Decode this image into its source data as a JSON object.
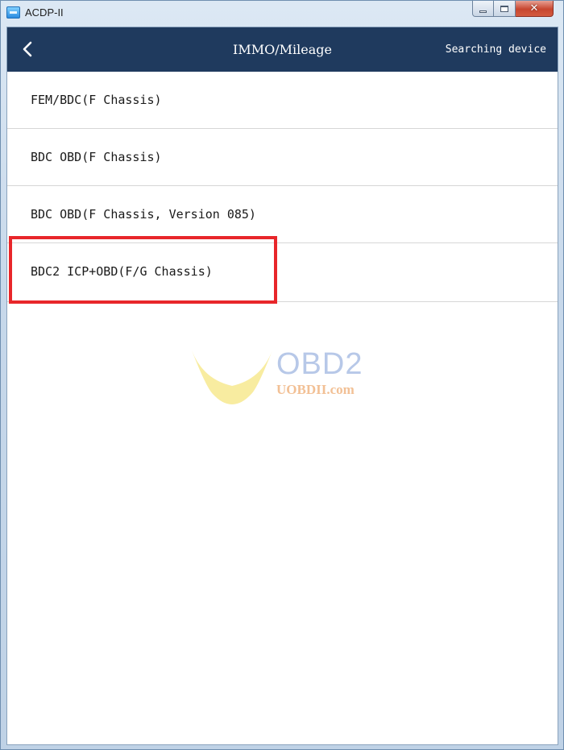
{
  "window": {
    "title": "ACDP-II",
    "close_symbol": "✕"
  },
  "header": {
    "back_icon": "chevron-left-icon",
    "title": "IMMO/Mileage",
    "status": "Searching device"
  },
  "menu": {
    "items": [
      {
        "label": "FEM/BDC(F Chassis)"
      },
      {
        "label": "BDC OBD(F Chassis)"
      },
      {
        "label": "BDC OBD(F Chassis, Version 085)"
      },
      {
        "label": "BDC2 ICP+OBD(F/G Chassis)",
        "highlighted": true
      }
    ]
  },
  "watermark": {
    "brand": "OBD2",
    "url": "UOBDII.com"
  },
  "colors": {
    "header_background": "#1f3a5e",
    "highlight_border": "#e8262a",
    "watermark_brand": "#b7c8e8",
    "watermark_url": "#f2c095"
  }
}
